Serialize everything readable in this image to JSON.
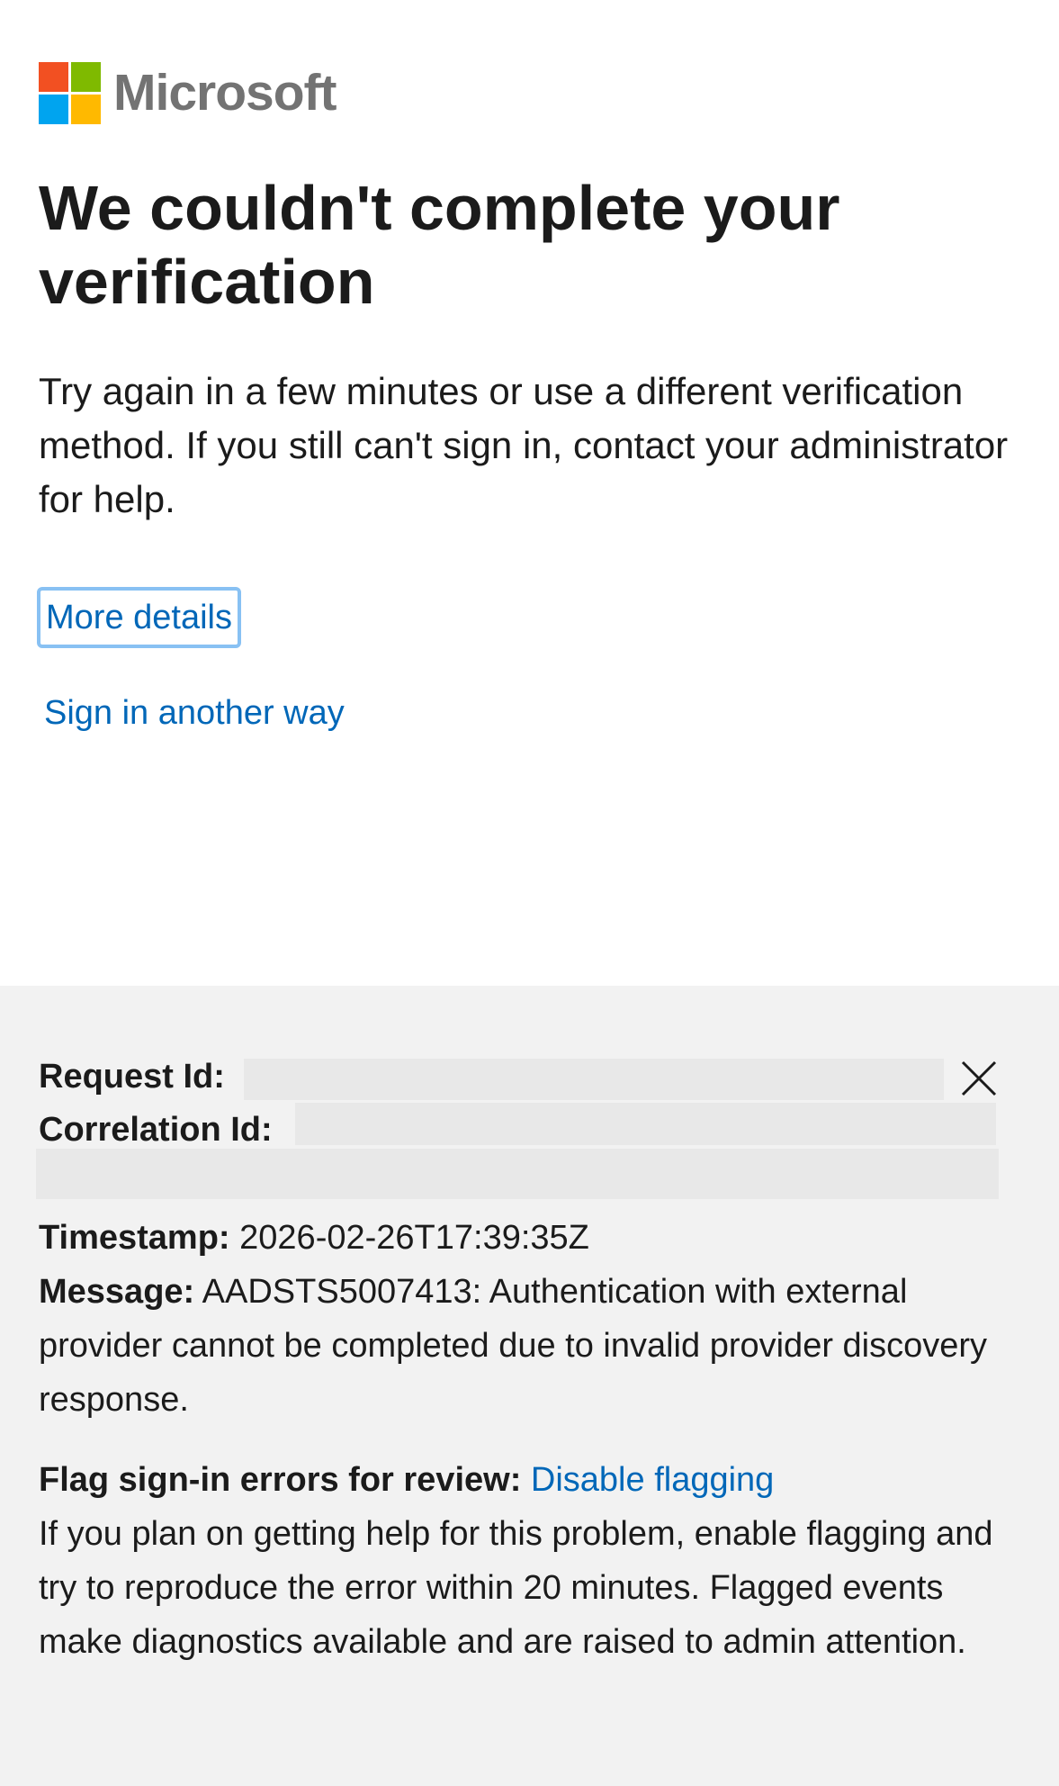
{
  "brand": {
    "name": "Microsoft",
    "logo_colors": [
      "#f25022",
      "#7fba00",
      "#00a4ef",
      "#ffb900"
    ]
  },
  "main": {
    "title": "We couldn't complete your verification",
    "description": "Try again in a few minutes or use a different verification method. If you still can't sign in, contact your administrator for help.",
    "more_details_label": "More details",
    "sign_in_another_way_label": "Sign in another way"
  },
  "details": {
    "request_id_label": "Request Id:",
    "request_id_value": "",
    "correlation_id_label": "Correlation Id:",
    "correlation_id_value": "",
    "timestamp_label": "Timestamp:",
    "timestamp_value": "2026-02-26T17:39:35Z",
    "message_label": "Message:",
    "message_value": "AADSTS5007413: Authentication with external provider cannot be completed due to invalid provider discovery response.",
    "flag_label": "Flag sign-in errors for review:",
    "flag_link": "Disable flagging",
    "flag_description": "If you plan on getting help for this problem, enable flagging and try to reproduce the error within 20 minutes. Flagged events make diagnostics available and are raised to admin attention."
  },
  "icons": {
    "close": "close-icon"
  },
  "colors": {
    "link": "#0067b8",
    "focus_outline": "#88c1f3",
    "details_background": "#f2f2f2"
  }
}
